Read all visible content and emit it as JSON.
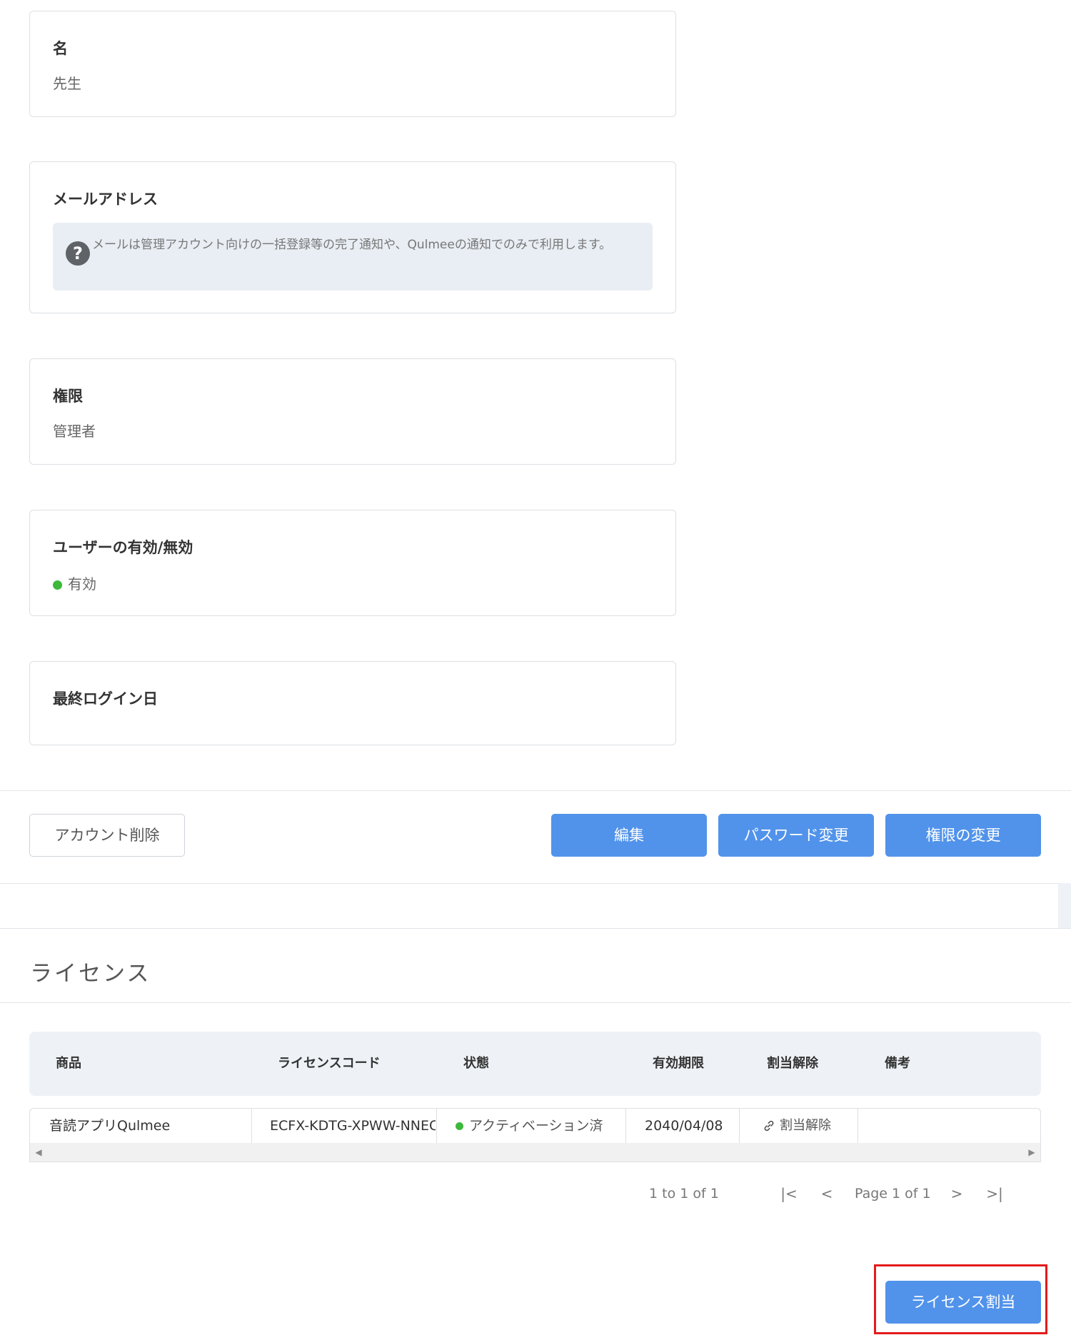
{
  "fields": {
    "first_name": {
      "label": "名",
      "value": "先生"
    },
    "email": {
      "label": "メールアドレス",
      "info_icon": "question-circle-icon",
      "info_text": "メールは管理アカウント向けの一括登録等の完了通知や、Qulmeeの通知でのみで利用します。"
    },
    "role": {
      "label": "権限",
      "value": "管理者"
    },
    "status": {
      "label": "ユーザーの有効/無効",
      "value": "有効",
      "color": "#3db83a"
    },
    "last_login": {
      "label": "最終ログイン日",
      "value": ""
    }
  },
  "actions": {
    "delete_account": "アカウント削除",
    "edit": "編集",
    "change_password": "パスワード変更",
    "change_role": "権限の変更",
    "primary_color": "#5193ea"
  },
  "license": {
    "title": "ライセンス",
    "columns": [
      "商品",
      "ライセンスコード",
      "状態",
      "有効期限",
      "割当解除",
      "備考"
    ],
    "rows": [
      {
        "product": "音読アプリQulmee",
        "code": "ECFX-KDTG-XPWW-NNEC",
        "status": "アクティベーション済",
        "status_color": "#3db83a",
        "expiry": "2040/04/08",
        "unassign": "割当解除",
        "unassign_icon": "link-icon",
        "note": ""
      }
    ],
    "pagination": {
      "summary": "1 to 1 of 1",
      "page_label": "Page 1 of 1",
      "first_icon": "first-page-icon",
      "prev_icon": "prev-page-icon",
      "next_icon": "next-page-icon",
      "last_icon": "last-page-icon"
    },
    "assign_button": "ライセンス割当",
    "highlight_color": "#e31b1b"
  }
}
